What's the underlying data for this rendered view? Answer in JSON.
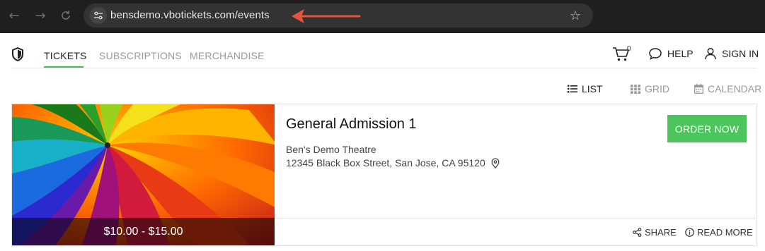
{
  "browser": {
    "url": "bensdemo.vbotickets.com/events",
    "back_icon": "back-arrow-icon",
    "forward_icon": "forward-arrow-icon",
    "reload_icon": "reload-icon",
    "bookmark_icon": "star-icon",
    "annotation_color": "#e8533f"
  },
  "header": {
    "logo_icon": "shield-icon",
    "nav": [
      {
        "label": "TICKETS",
        "active": true
      },
      {
        "label": "SUBSCRIPTIONS",
        "active": false
      },
      {
        "label": "MERCHANDISE",
        "active": false
      }
    ],
    "cart_count": "0",
    "help_label": "HELP",
    "signin_label": "SIGN IN",
    "accent_color": "#4dbb5a"
  },
  "views": {
    "list_label": "LIST",
    "grid_label": "GRID",
    "calendar_label": "CALENDAR",
    "active": "LIST"
  },
  "event": {
    "title": "General Admission 1",
    "venue": "Ben's Demo Theatre",
    "address": "12345 Black Box Street, San Jose, CA 95120",
    "price": "$10.00 - $15.00",
    "order_label": "ORDER NOW",
    "share_label": "SHARE",
    "readmore_label": "READ MORE",
    "order_button_color": "#4cc55c"
  }
}
